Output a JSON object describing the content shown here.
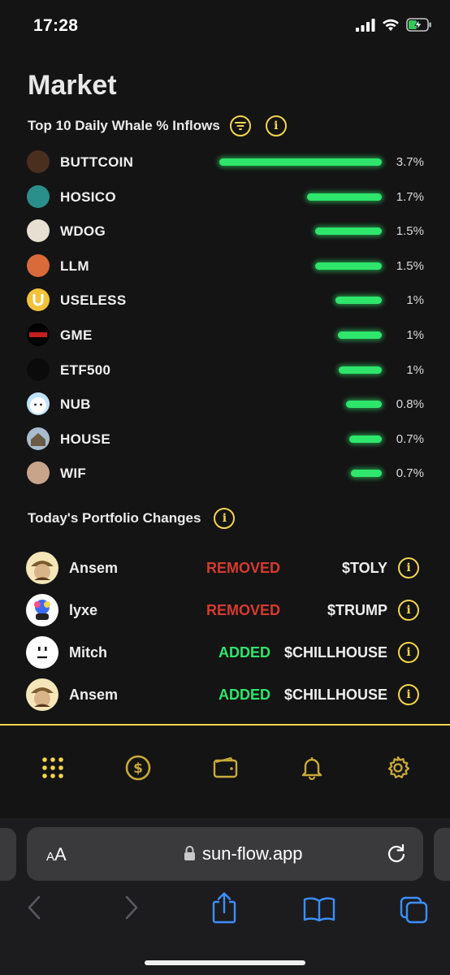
{
  "status_bar": {
    "time": "17:28"
  },
  "page": {
    "title": "Market"
  },
  "inflows": {
    "heading": "Top 10 Daily Whale % Inflows",
    "filter_icon": "filter-icon",
    "info_icon": "info-icon",
    "accent_color": "#2ee66b",
    "items": [
      {
        "name": "BUTTCOIN",
        "percent_label": "3.7%",
        "value": 3.7,
        "avatar_color": "#4a2e1e"
      },
      {
        "name": "HOSICO",
        "percent_label": "1.7%",
        "value": 1.7,
        "avatar_color": "#2a8f8a"
      },
      {
        "name": "WDOG",
        "percent_label": "1.5%",
        "value": 1.5,
        "avatar_color": "#e6dfd2"
      },
      {
        "name": "LLM",
        "percent_label": "1.5%",
        "value": 1.5,
        "avatar_color": "#d96a3a"
      },
      {
        "name": "USELESS",
        "percent_label": "1%",
        "value": 1.0,
        "avatar_color": "#f2c23a"
      },
      {
        "name": "GME",
        "percent_label": "1%",
        "value": 1.0,
        "avatar_color": "#000000"
      },
      {
        "name": "ETF500",
        "percent_label": "1%",
        "value": 1.0,
        "avatar_color": "#0b0b0b"
      },
      {
        "name": "NUB",
        "percent_label": "0.8%",
        "value": 0.8,
        "avatar_color": "#bfe3ff"
      },
      {
        "name": "HOUSE",
        "percent_label": "0.7%",
        "value": 0.7,
        "avatar_color": "#a9bccf"
      },
      {
        "name": "WIF",
        "percent_label": "0.7%",
        "value": 0.7,
        "avatar_color": "#c8a48a"
      }
    ]
  },
  "changes": {
    "heading": "Today's Portfolio Changes",
    "removed_color": "#d63a2f",
    "added_color": "#2ee66b",
    "items": [
      {
        "user": "Ansem",
        "action": "REMOVED",
        "token": "$TOLY"
      },
      {
        "user": "lyxe",
        "action": "REMOVED",
        "token": "$TRUMP"
      },
      {
        "user": "Mitch",
        "action": "ADDED",
        "token": "$CHILLHOUSE"
      },
      {
        "user": "Ansem",
        "action": "ADDED",
        "token": "$CHILLHOUSE"
      }
    ]
  },
  "nav": {
    "icons": [
      "grid-icon",
      "dollar-icon",
      "wallet-icon",
      "bell-icon",
      "gear-icon"
    ],
    "active_color": "#f3d54e",
    "inactive_color": "#c8a93a"
  },
  "browser": {
    "aa_label": "AA",
    "url": "sun-flow.app"
  }
}
